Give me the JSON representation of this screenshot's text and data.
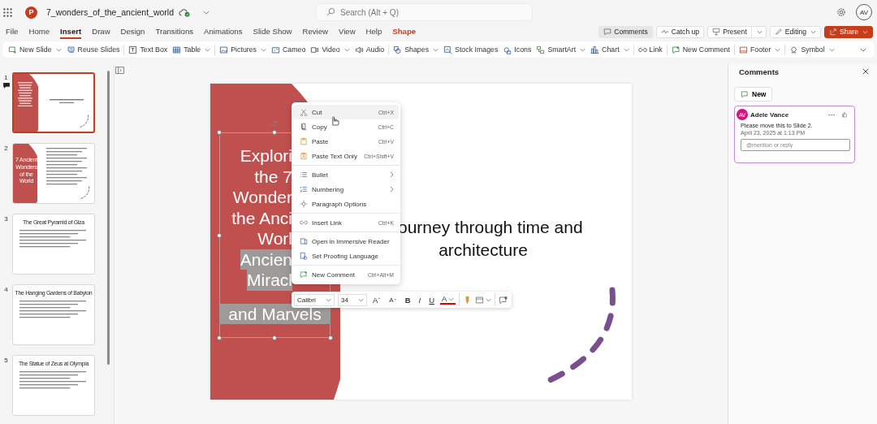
{
  "app": {
    "logo": "P",
    "file_name": "7_wonders_of_the_ancient_world",
    "search": {
      "placeholder": "Search (Alt + Q)"
    },
    "user_initials": "AV"
  },
  "tabs": [
    {
      "label": "File",
      "selected": false,
      "kind": "standard"
    },
    {
      "label": "Home",
      "selected": false,
      "kind": "standard"
    },
    {
      "label": "Insert",
      "selected": true,
      "kind": "standard"
    },
    {
      "label": "Draw",
      "selected": false,
      "kind": "standard"
    },
    {
      "label": "Design",
      "selected": false,
      "kind": "standard"
    },
    {
      "label": "Transitions",
      "selected": false,
      "kind": "standard"
    },
    {
      "label": "Animations",
      "selected": false,
      "kind": "standard"
    },
    {
      "label": "Slide Show",
      "selected": false,
      "kind": "standard"
    },
    {
      "label": "Review",
      "selected": false,
      "kind": "standard"
    },
    {
      "label": "View",
      "selected": false,
      "kind": "standard"
    },
    {
      "label": "Help",
      "selected": false,
      "kind": "standard"
    },
    {
      "label": "Shape",
      "selected": false,
      "kind": "contextual"
    }
  ],
  "actions": [
    {
      "label": "Comments",
      "kind": "toggle",
      "on": true
    },
    {
      "label": "Catch up",
      "kind": "plain",
      "on": false
    },
    {
      "label": "Present",
      "kind": "split",
      "on": false
    },
    {
      "label": "Editing",
      "kind": "dropdown",
      "on": false
    },
    {
      "label": "Share",
      "kind": "primary",
      "on": false
    }
  ],
  "ribbon": {
    "groups": [
      [
        {
          "label": "New Slide",
          "dropdown": true
        },
        {
          "label": "Reuse Slides",
          "dropdown": false
        }
      ],
      [
        {
          "label": "Text Box",
          "dropdown": false
        },
        {
          "label": "Table",
          "dropdown": true
        }
      ],
      [
        {
          "label": "Pictures",
          "dropdown": true
        },
        {
          "label": "Cameo",
          "dropdown": false
        },
        {
          "label": "Video",
          "dropdown": true
        },
        {
          "label": "Audio",
          "dropdown": false
        }
      ],
      [
        {
          "label": "Shapes",
          "dropdown": true
        },
        {
          "label": "Stock Images",
          "dropdown": false
        },
        {
          "label": "Icons",
          "dropdown": false
        },
        {
          "label": "SmartArt",
          "dropdown": true
        },
        {
          "label": "Chart",
          "dropdown": true
        }
      ],
      [
        {
          "label": "Link",
          "dropdown": false
        }
      ],
      [
        {
          "label": "New Comment",
          "dropdown": false
        }
      ],
      [
        {
          "label": "Footer",
          "dropdown": true
        }
      ],
      [
        {
          "label": "Symbol",
          "dropdown": true
        }
      ]
    ]
  },
  "slides": [
    {
      "number": "1",
      "kind": "title",
      "selected": true,
      "has_comment": true
    },
    {
      "number": "2",
      "kind": "section",
      "selected": false,
      "has_comment": false,
      "title": "7 Ancient Wonders of the World"
    },
    {
      "number": "3",
      "kind": "content",
      "selected": false,
      "has_comment": false,
      "title": "The Great Pyramid of Giza"
    },
    {
      "number": "4",
      "kind": "content",
      "selected": false,
      "has_comment": false,
      "title": "The Hanging Gardens of Babylon"
    },
    {
      "number": "5",
      "kind": "content",
      "selected": false,
      "has_comment": false,
      "title": "The Statue of Zeus at Olympia"
    }
  ],
  "editor": {
    "title_lines": [
      {
        "text": "Explori",
        "cut": true,
        "selected": false
      },
      {
        "text": "the 7",
        "cut": true,
        "selected": false
      },
      {
        "text": "Wonder",
        "cut": true,
        "selected": false
      },
      {
        "text": "the Anci",
        "cut": true,
        "selected": false
      },
      {
        "text": "Worl",
        "cut": true,
        "selected": false
      },
      {
        "text": "Ancien",
        "cut": true,
        "selected": true
      },
      {
        "text": "Miracl",
        "cut": true,
        "selected": true
      },
      {
        "text": "and Marvels",
        "cut": false,
        "selected": true
      }
    ],
    "subtitle_lines": [
      "ourney through time and",
      "architecture"
    ]
  },
  "context_menu": {
    "groups": [
      [
        {
          "label": "Cut",
          "shortcut": "Ctrl+X",
          "submenu": false,
          "highlighted": true
        },
        {
          "label": "Copy",
          "shortcut": "Ctrl+C",
          "submenu": false,
          "highlighted": false
        },
        {
          "label": "Paste",
          "shortcut": "Ctrl+V",
          "submenu": false,
          "highlighted": false
        },
        {
          "label": "Paste Text Only",
          "shortcut": "Ctrl+Shift+V",
          "submenu": false,
          "highlighted": false
        }
      ],
      [
        {
          "label": "Bullet",
          "submenu": true,
          "highlighted": false
        },
        {
          "label": "Numbering",
          "submenu": true,
          "highlighted": false
        },
        {
          "label": "Paragraph Options",
          "submenu": false,
          "highlighted": false
        }
      ],
      [
        {
          "label": "Insert Link",
          "shortcut": "Ctrl+K",
          "submenu": false,
          "highlighted": false
        }
      ],
      [
        {
          "label": "Open in Immersive Reader",
          "submenu": false,
          "highlighted": false
        },
        {
          "label": "Set Proofing Language",
          "submenu": false,
          "highlighted": false
        }
      ],
      [
        {
          "label": "New Comment",
          "shortcut": "Ctrl+Alt+M",
          "submenu": false,
          "highlighted": false
        }
      ]
    ]
  },
  "mini_toolbar": {
    "font": "Calibri",
    "size": "34",
    "format_buttons": [
      "A",
      "A",
      "B",
      "I",
      "U",
      "A"
    ]
  },
  "comments_panel": {
    "title": "Comments",
    "new_label": "New",
    "comments": [
      {
        "initials": "AV",
        "author": "Adele Vance",
        "text": "Please move this to Slide 2.",
        "date": "April 23, 2025 at 1:13 PM",
        "reply_placeholder": "@mention or reply"
      }
    ]
  }
}
